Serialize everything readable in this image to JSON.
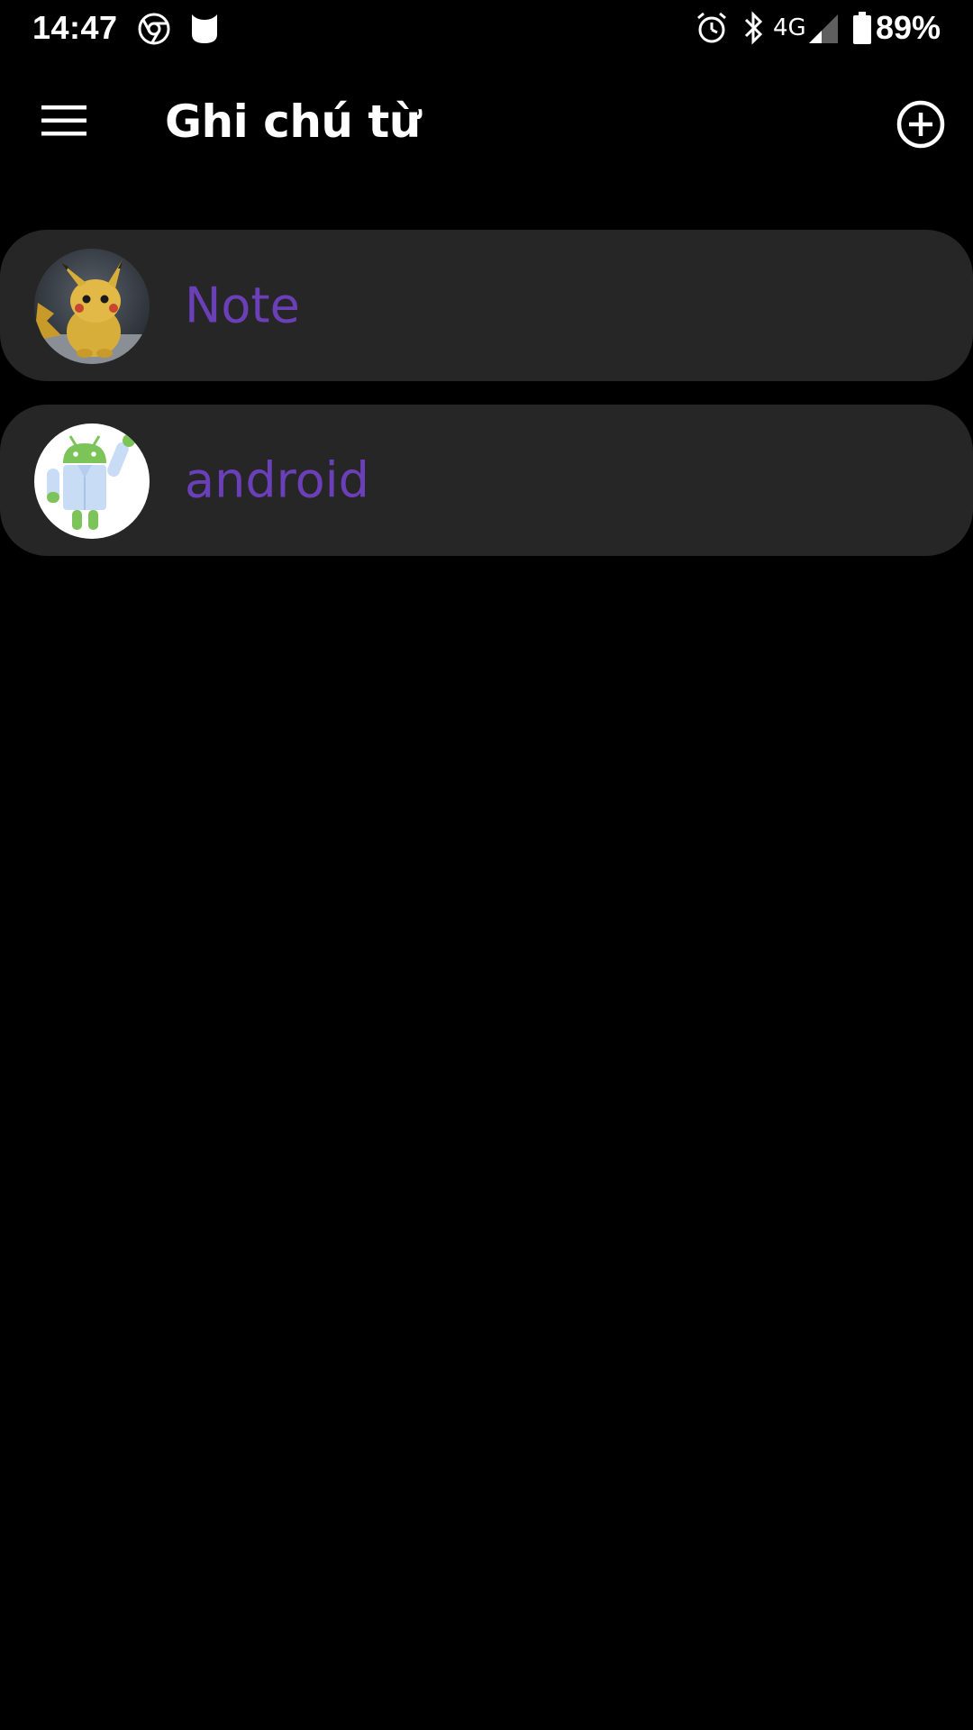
{
  "status_bar": {
    "time": "14:47",
    "network": "4G",
    "battery": "89%",
    "icons": [
      "chrome-icon",
      "app-notification-icon",
      "alarm-icon",
      "bluetooth-icon",
      "signal-icon",
      "battery-icon"
    ]
  },
  "app_bar": {
    "title": "Ghi chú từ",
    "menu_icon": "hamburger-menu-icon",
    "add_icon": "add-circle-icon"
  },
  "notes": [
    {
      "title": "Note",
      "avatar": "pikachu-avatar"
    },
    {
      "title": "android",
      "avatar": "android-avatar"
    }
  ],
  "colors": {
    "background": "#000000",
    "card": "#262626",
    "accent": "#6a3fb8",
    "text": "#ffffff"
  }
}
